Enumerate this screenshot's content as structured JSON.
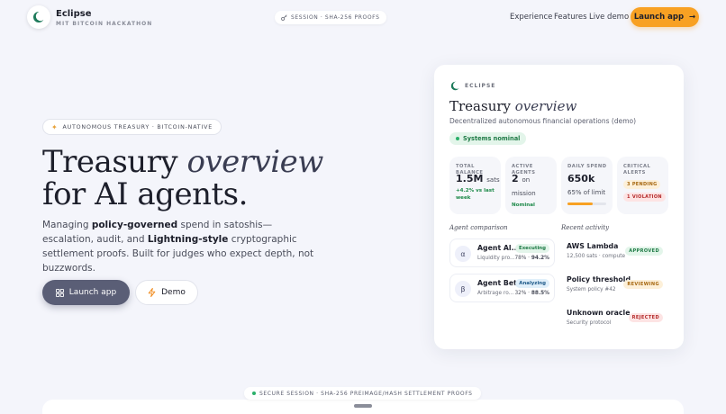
{
  "header": {
    "brand_name": "Eclipse",
    "brand_subtitle": "MIT BITCOIN HACKATHON",
    "session_label": "SESSION · SHA-256 PROOFS",
    "nav": [
      "Experience",
      "Features",
      "Live demo"
    ],
    "launch_button": "Launch app"
  },
  "hero": {
    "badge": "AUTONOMOUS TREASURY · BITCOIN-NATIVE",
    "title_part1": "Treasury ",
    "title_italic": "overview",
    "title_line2": "for AI agents.",
    "desc_1": "Managing ",
    "desc_bold1": "policy-governed",
    "desc_2": " spend in satoshis— escalation, audit, and ",
    "desc_bold2": "Lightning-style",
    "desc_3": " cryptographic settlement proofs. Built for judges who expect depth, not buzzwords.",
    "launch_button": "Launch app",
    "demo_button": "Demo"
  },
  "card": {
    "brand": "ECLIPSE",
    "title_part1": "Treasury ",
    "title_italic": "overview",
    "subtitle": "Decentralized autonomous financial operations (demo)",
    "status": "Systems nominal",
    "stats": {
      "total_balance": {
        "label": "TOTAL BALANCE",
        "value": "1.5M",
        "unit": "sats",
        "note": "+4.2% vs last week"
      },
      "active_agents": {
        "label": "ACTIVE AGENTS",
        "value": "2",
        "unit": "on",
        "unit2": "mission",
        "note": "Nominal"
      },
      "daily_spend": {
        "label": "DAILY SPEND",
        "value": "650k",
        "note": "65% of limit",
        "progress": 0.65
      },
      "critical_alerts": {
        "label": "CRITICAL ALERTS",
        "pending": "3 PENDING",
        "violation": "1 VIOLATION"
      }
    },
    "agent_heading": "Agent comparison",
    "agents": [
      {
        "avatar": "α",
        "name": "Agent Al...",
        "meta": "Liquidity pro...",
        "tag": "Executing",
        "stat1": "78%",
        "stat2": "94.2%"
      },
      {
        "avatar": "β",
        "name": "Agent Beta",
        "meta": "Arbitrage ro...",
        "tag": "Analyzing",
        "stat1": "32%",
        "stat2": "88.5%"
      }
    ],
    "activity_heading": "Recent activity",
    "activity": [
      {
        "title": "AWS Lambda",
        "sub": "12,500 sats · compute",
        "tag": "APPROVED"
      },
      {
        "title": "Policy threshold",
        "sub": "System policy #42",
        "tag": "REVIEWING"
      },
      {
        "title": "Unknown oracle",
        "sub": "Security protocol",
        "tag": "REJECTED"
      }
    ]
  },
  "footer": {
    "secure_label": "SECURE SESSION · SHA-256 PREIMAGE/HASH SETTLEMENT PROOFS"
  },
  "colors": {
    "accent_orange": "#f8a123",
    "primary_button": "#5a5e76",
    "success_green": "#2bb06a"
  }
}
